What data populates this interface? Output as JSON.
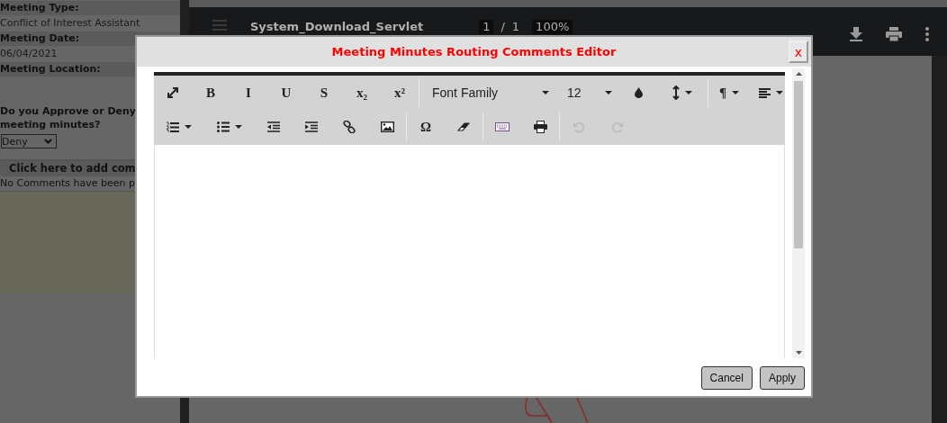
{
  "left_panel": {
    "fields": [
      {
        "label": "Meeting Type:",
        "value": "Conflict of Interest Assistant"
      },
      {
        "label": "Meeting Date:",
        "value": "06/04/2021"
      },
      {
        "label": "Meeting Location:"
      }
    ],
    "question": [
      "Do you Approve or Deny",
      "meeting minutes?"
    ],
    "decision": {
      "value": "Deny"
    },
    "comments_header": "Click here to add com",
    "comments_empty": "No Comments have been p"
  },
  "viewer": {
    "title": "System_Download_Servlet",
    "page": "1",
    "page_sep": "/",
    "page_count": "1",
    "zoom": "100%"
  },
  "dialog": {
    "title": "Meeting Minutes Routing Comments Editor",
    "close": "x",
    "toolbar": [
      {
        "groups": [
          [
            {
              "kind": "button"
            },
            {
              "kind": "button",
              "label": "B"
            },
            {
              "kind": "button",
              "label": "I"
            },
            {
              "kind": "button",
              "label": "U"
            },
            {
              "kind": "button",
              "label": "S"
            },
            {
              "kind": "button",
              "label": "x₂"
            },
            {
              "kind": "button",
              "label": "x²"
            }
          ],
          [
            {
              "kind": "dropdown",
              "label": "Font Family"
            },
            {
              "kind": "dropdown",
              "label": "12"
            },
            {
              "kind": "button"
            },
            {
              "kind": "split"
            }
          ],
          [
            {
              "kind": "split",
              "label": "¶"
            },
            {
              "kind": "split"
            }
          ]
        ]
      },
      {
        "groups": [
          [
            {
              "kind": "split"
            },
            {
              "kind": "split"
            },
            {
              "kind": "button"
            },
            {
              "kind": "button"
            },
            {
              "kind": "button"
            },
            {
              "kind": "button"
            }
          ],
          [
            {
              "kind": "button",
              "label": "Ω"
            },
            {
              "kind": "button"
            }
          ],
          [
            {
              "kind": "button"
            },
            {
              "kind": "button"
            }
          ],
          [
            {
              "kind": "button",
              "disabled": true
            },
            {
              "kind": "button",
              "disabled": true
            }
          ]
        ]
      }
    ],
    "buttons": [
      "Cancel",
      "Apply"
    ]
  }
}
